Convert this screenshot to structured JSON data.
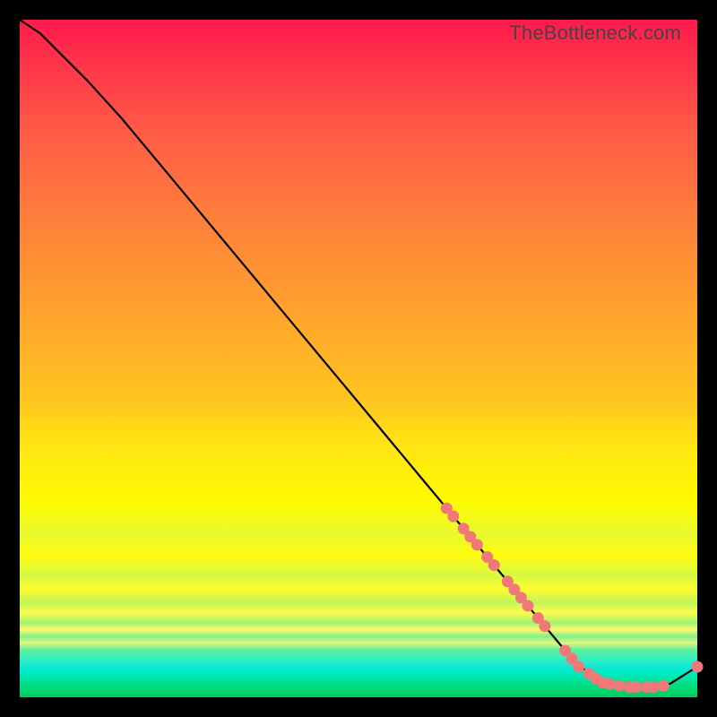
{
  "watermark": "TheBottleneck.com",
  "colors": {
    "line": "#000000",
    "marker": "#f07878",
    "background_frame": "#000000"
  },
  "chart_data": {
    "type": "line",
    "title": "",
    "xlabel": "",
    "ylabel": "",
    "xlim": [
      0,
      100
    ],
    "ylim": [
      0,
      100
    ],
    "grid": false,
    "legend": false,
    "series": [
      {
        "name": "curve",
        "x": [
          0,
          3,
          6,
          10,
          15,
          20,
          25,
          30,
          35,
          40,
          45,
          50,
          55,
          60,
          63,
          66,
          69,
          72,
          75,
          78,
          81,
          84,
          87,
          90,
          93,
          96,
          100
        ],
        "y": [
          100,
          98,
          95,
          91,
          85.5,
          79.5,
          73.5,
          67.5,
          61.5,
          55.5,
          49.5,
          43.5,
          37.5,
          31.5,
          27.9,
          24.3,
          20.7,
          17.1,
          13.5,
          9.9,
          6.3,
          3.5,
          2.0,
          1.5,
          1.5,
          2.0,
          4.5
        ]
      }
    ],
    "markers": [
      {
        "x": 63.0,
        "y": 27.9
      },
      {
        "x": 64.0,
        "y": 26.7
      },
      {
        "x": 65.5,
        "y": 24.9
      },
      {
        "x": 66.5,
        "y": 23.7
      },
      {
        "x": 67.5,
        "y": 22.5
      },
      {
        "x": 69.0,
        "y": 20.7
      },
      {
        "x": 70.0,
        "y": 19.5
      },
      {
        "x": 72.0,
        "y": 17.1
      },
      {
        "x": 73.0,
        "y": 15.9
      },
      {
        "x": 74.0,
        "y": 14.7
      },
      {
        "x": 75.0,
        "y": 13.5
      },
      {
        "x": 76.5,
        "y": 11.7
      },
      {
        "x": 77.5,
        "y": 10.5
      },
      {
        "x": 80.5,
        "y": 6.9
      },
      {
        "x": 81.5,
        "y": 5.7
      },
      {
        "x": 82.5,
        "y": 4.5
      },
      {
        "x": 84.0,
        "y": 3.5
      },
      {
        "x": 85.0,
        "y": 2.8
      },
      {
        "x": 86.0,
        "y": 2.2
      },
      {
        "x": 87.0,
        "y": 2.0
      },
      {
        "x": 88.5,
        "y": 1.7
      },
      {
        "x": 90.0,
        "y": 1.5
      },
      {
        "x": 91.0,
        "y": 1.5
      },
      {
        "x": 92.5,
        "y": 1.5
      },
      {
        "x": 93.5,
        "y": 1.5
      },
      {
        "x": 95.0,
        "y": 1.7
      },
      {
        "x": 100.0,
        "y": 4.5
      }
    ]
  }
}
